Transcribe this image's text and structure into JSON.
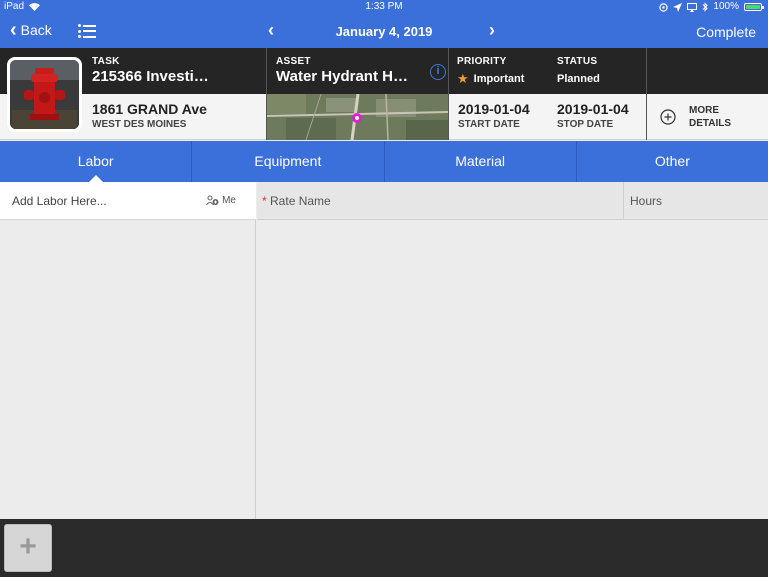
{
  "status_bar": {
    "device": "iPad",
    "time": "1:33 PM",
    "battery": "100%"
  },
  "nav": {
    "back_label": "Back",
    "date": "January 4, 2019",
    "complete_label": "Complete"
  },
  "task": {
    "task_label": "TASK",
    "task_value": "215366 Investi…",
    "asset_label": "ASSET",
    "asset_value": "Water Hydrant H…",
    "priority_label": "PRIORITY",
    "priority_value": "Important",
    "status_label": "STATUS",
    "status_value": "Planned",
    "address": "1861 GRAND Ave",
    "city": "WEST DES MOINES",
    "start_date": "2019-01-04",
    "start_label": "START DATE",
    "stop_date": "2019-01-04",
    "stop_label": "STOP DATE",
    "more_label_1": "MORE",
    "more_label_2": "DETAILS"
  },
  "tabs": [
    {
      "label": "Labor",
      "active": true
    },
    {
      "label": "Equipment",
      "active": false
    },
    {
      "label": "Material",
      "active": false
    },
    {
      "label": "Other",
      "active": false
    }
  ],
  "labor": {
    "add_placeholder": "Add Labor Here...",
    "me_label": "Me"
  },
  "table": {
    "required_marker": "*",
    "col_rate_name": "Rate Name",
    "col_hours": "Hours"
  },
  "bottom": {
    "add_button": "+"
  },
  "colors": {
    "accent": "#3b6fd9",
    "dark": "#252525",
    "priority_star": "#f0a030",
    "map_pin": "#e020d0"
  }
}
